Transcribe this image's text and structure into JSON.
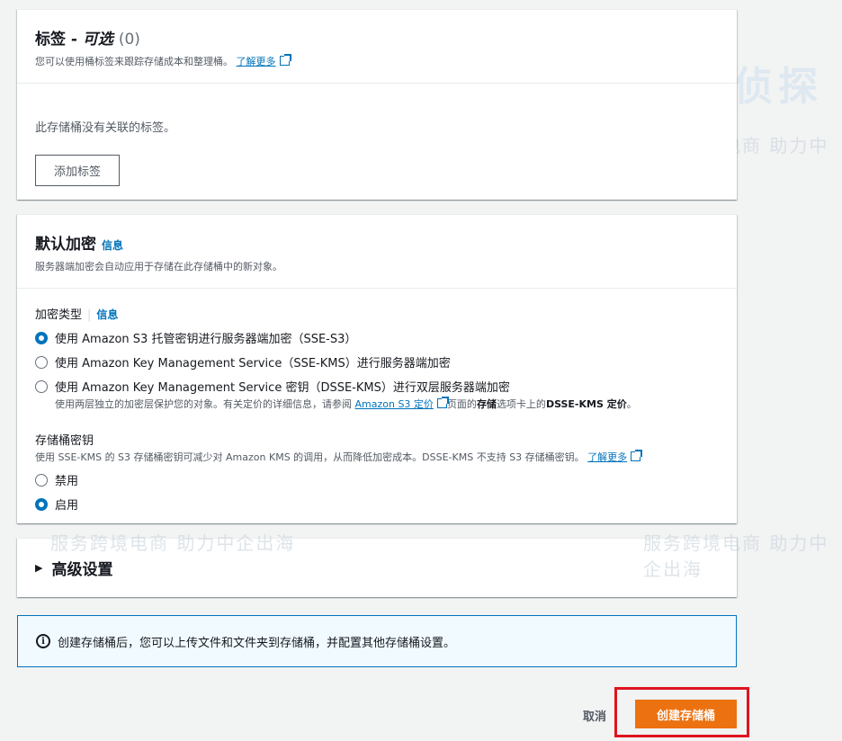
{
  "tags": {
    "title": "标签 - ",
    "title_opt": "可选",
    "count": "(0)",
    "description": "您可以使用桶标签来跟踪存储成本和整理桶。",
    "learn_more": "了解更多",
    "empty_text": "此存储桶没有关联的标签。",
    "add_button": "添加标签"
  },
  "encryption": {
    "title": "默认加密",
    "info": "信息",
    "description": "服务器端加密会自动应用于存储在此存储桶中的新对象。",
    "type_label": "加密类型",
    "type_info": "信息",
    "options": [
      "使用 Amazon S3 托管密钥进行服务器端加密（SSE-S3）",
      "使用 Amazon Key Management Service（SSE-KMS）进行服务器端加密",
      "使用 Amazon Key Management Service 密钥（DSSE-KMS）进行双层服务器端加密"
    ],
    "dsse_desc_pre": "使用两层独立的加密层保护您的对象。有关定价的详细信息，请参阅",
    "dsse_link": "Amazon S3 定价",
    "dsse_desc_mid": "页面的",
    "dsse_desc_bold1": "存储",
    "dsse_desc_mid2": "选项卡上的",
    "dsse_desc_bold2": "DSSE-KMS 定价",
    "dsse_desc_end": "。",
    "bucket_key_label": "存储桶密钥",
    "bucket_key_desc": "使用 SSE-KMS 的 S3 存储桶密钥可减少对 Amazon KMS 的调用，从而降低加密成本。DSSE-KMS 不支持 S3 存储桶密钥。",
    "bucket_key_learn_more": "了解更多",
    "bucket_key_options": [
      "禁用",
      "启用"
    ]
  },
  "advanced": {
    "title": "高级设置"
  },
  "alert": {
    "text": "创建存储桶后，您可以上传文件和文件夹到存储桶，并配置其他存储桶设置。"
  },
  "actions": {
    "cancel": "取消",
    "create": "创建存储桶"
  },
  "watermark": {
    "brand": "主机侦探",
    "slogan": "服务跨境电商 助力中企出海"
  }
}
